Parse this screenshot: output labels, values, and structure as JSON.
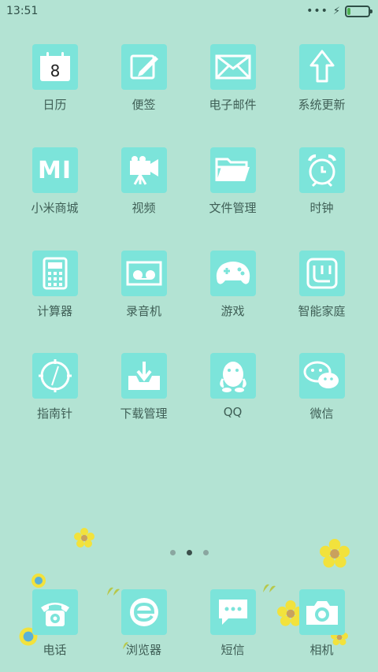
{
  "status": {
    "time": "13:51"
  },
  "apps": [
    {
      "label": "日历",
      "icon": "calendar-icon",
      "badge": "8"
    },
    {
      "label": "便签",
      "icon": "notes-icon"
    },
    {
      "label": "电子邮件",
      "icon": "mail-icon"
    },
    {
      "label": "系统更新",
      "icon": "update-icon"
    },
    {
      "label": "小米商城",
      "icon": "mi-store-icon",
      "badge": "MI"
    },
    {
      "label": "视频",
      "icon": "video-icon"
    },
    {
      "label": "文件管理",
      "icon": "folder-icon"
    },
    {
      "label": "时钟",
      "icon": "clock-icon"
    },
    {
      "label": "计算器",
      "icon": "calculator-icon"
    },
    {
      "label": "录音机",
      "icon": "recorder-icon"
    },
    {
      "label": "游戏",
      "icon": "gamepad-icon"
    },
    {
      "label": "智能家庭",
      "icon": "smart-home-icon"
    },
    {
      "label": "指南针",
      "icon": "compass-icon"
    },
    {
      "label": "下载管理",
      "icon": "download-icon"
    },
    {
      "label": "QQ",
      "icon": "qq-icon"
    },
    {
      "label": "微信",
      "icon": "wechat-icon"
    }
  ],
  "dock": [
    {
      "label": "电话",
      "icon": "phone-icon"
    },
    {
      "label": "浏览器",
      "icon": "browser-icon"
    },
    {
      "label": "短信",
      "icon": "sms-icon"
    },
    {
      "label": "相机",
      "icon": "camera-icon"
    }
  ],
  "colors": {
    "background": "#b3e3d3",
    "tile": "#7ce4da",
    "label": "#3f5f56"
  }
}
